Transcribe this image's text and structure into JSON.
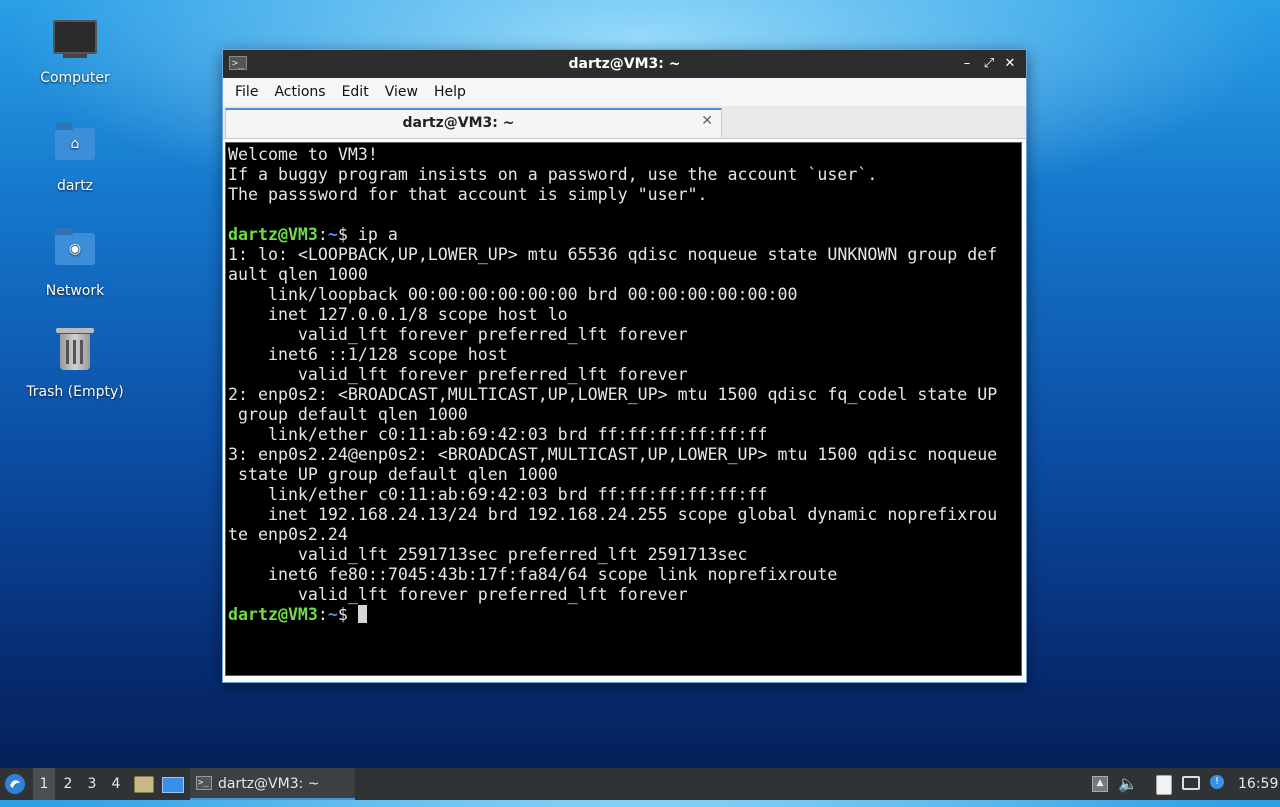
{
  "desktop": {
    "icons": [
      {
        "label": "Computer"
      },
      {
        "label": "dartz"
      },
      {
        "label": "Network"
      },
      {
        "label": "Trash (Empty)"
      }
    ]
  },
  "window": {
    "title": "dartz@VM3: ~",
    "controls": {
      "minimize": "–",
      "maximize": "⤢",
      "close": "✕"
    },
    "menu": [
      "File",
      "Actions",
      "Edit",
      "View",
      "Help"
    ],
    "tab": {
      "label": "dartz@VM3: ~",
      "close": "✕"
    }
  },
  "terminal": {
    "prompt_user": "dartz@VM3",
    "prompt_sep": ":",
    "prompt_path": "~",
    "prompt_sym": "$ ",
    "motd": "Welcome to VM3!\nIf a buggy program insists on a password, use the account `user`.\nThe passsword for that account is simply \"user\".\n",
    "command": "ip a",
    "output": "1: lo: <LOOPBACK,UP,LOWER_UP> mtu 65536 qdisc noqueue state UNKNOWN group def\nault qlen 1000\n    link/loopback 00:00:00:00:00:00 brd 00:00:00:00:00:00\n    inet 127.0.0.1/8 scope host lo\n       valid_lft forever preferred_lft forever\n    inet6 ::1/128 scope host\n       valid_lft forever preferred_lft forever\n2: enp0s2: <BROADCAST,MULTICAST,UP,LOWER_UP> mtu 1500 qdisc fq_codel state UP\n group default qlen 1000\n    link/ether c0:11:ab:69:42:03 brd ff:ff:ff:ff:ff:ff\n3: enp0s2.24@enp0s2: <BROADCAST,MULTICAST,UP,LOWER_UP> mtu 1500 qdisc noqueue\n state UP group default qlen 1000\n    link/ether c0:11:ab:69:42:03 brd ff:ff:ff:ff:ff:ff\n    inet 192.168.24.13/24 brd 192.168.24.255 scope global dynamic noprefixrou\nte enp0s2.24\n       valid_lft 2591713sec preferred_lft 2591713sec\n    inet6 fe80::7045:43b:17f:fa84/64 scope link noprefixroute\n       valid_lft forever preferred_lft forever"
  },
  "taskbar": {
    "workspaces": [
      "1",
      "2",
      "3",
      "4"
    ],
    "window_button": "dartz@VM3: ~",
    "clock": "16:59"
  }
}
